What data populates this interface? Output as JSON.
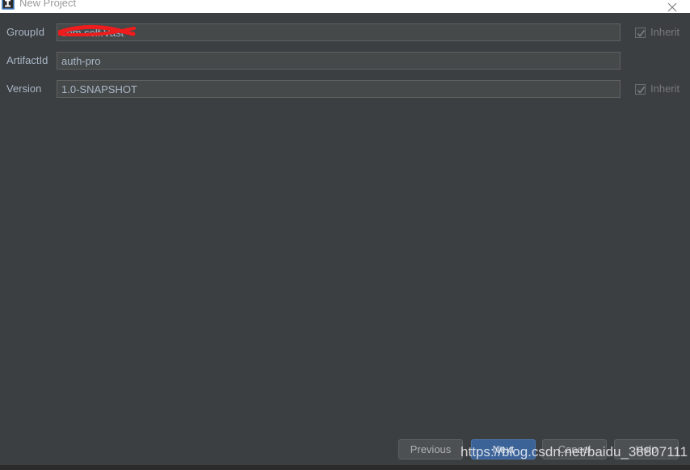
{
  "window": {
    "title": "New Project",
    "app_icon": "intellij-idea-icon",
    "close_icon": "close-icon",
    "background_color": "#3c3f41",
    "titlebar_background": "#ffffff"
  },
  "form": {
    "rows": [
      {
        "label": "GroupId",
        "value": "com.self.Vast",
        "redacted": true,
        "inherit": {
          "label": "Inherit",
          "checked": true,
          "disabled": true
        }
      },
      {
        "label": "ArtifactId",
        "value": "auth-pro",
        "redacted": false,
        "inherit": null
      },
      {
        "label": "Version",
        "value": "1.0-SNAPSHOT",
        "redacted": false,
        "inherit": {
          "label": "Inherit",
          "checked": true,
          "disabled": true
        }
      }
    ]
  },
  "buttons": {
    "previous": "Previous",
    "next": "Next",
    "cancel": "Cancel",
    "help": "Help",
    "default_button": "Next",
    "default_button_color": "#3c6398"
  },
  "watermark": {
    "text": "https://blog.csdn.net/baidu_38807111"
  }
}
